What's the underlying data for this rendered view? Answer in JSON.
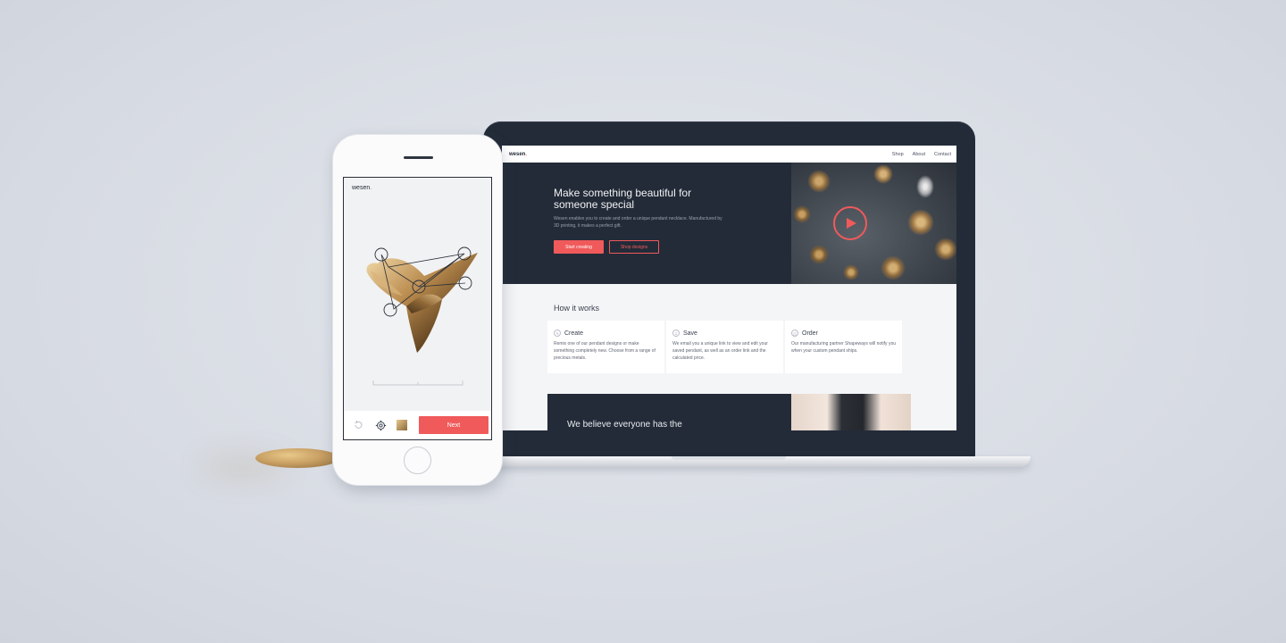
{
  "website": {
    "logo": "wesen",
    "logo_dot": ".",
    "nav": [
      "Shop",
      "About",
      "Contact"
    ],
    "hero": {
      "title_line1": "Make something beautiful for",
      "title_line2": "someone special",
      "subtitle": "Wesen enables you to create and order a unique pendant necklace. Manufactured by 3D printing, it makes a perfect gift.",
      "primary_button": "Start creating",
      "secondary_button": "Shop designs"
    },
    "how": {
      "title": "How it works",
      "steps": [
        {
          "title": "Create",
          "text": "Remix one of our pendant designs or make something completely new. Choose from a range of precious metals."
        },
        {
          "title": "Save",
          "text": "We email you a unique link to view and edit your saved pendant, as well as an order link and the calculated price."
        },
        {
          "title": "Order",
          "text": "Our manufacturing partner Shapeways will notify you when your custom pendant ships."
        }
      ]
    },
    "believe_text": "We believe everyone has the"
  },
  "app": {
    "logo": "wesen",
    "logo_dot": ".",
    "next_button": "Next",
    "icons": [
      "undo-icon",
      "settings-icon",
      "material-swatch-icon"
    ]
  },
  "colors": {
    "accent": "#f05a5b",
    "dark": "#232b38",
    "light_bg": "#f4f5f7",
    "page_bg": "#d9dde5"
  }
}
